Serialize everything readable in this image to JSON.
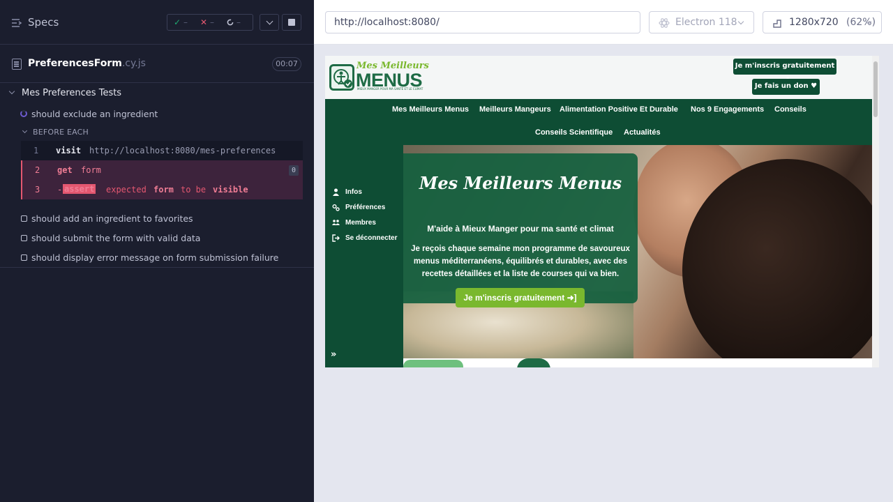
{
  "reporter": {
    "title": "Specs",
    "stats": {
      "passed": "✓",
      "passed_count": "–",
      "failed": "✕",
      "failed_count": "–",
      "pending_count": "–"
    },
    "file": {
      "name": "PreferencesForm",
      "ext": ".cy.js",
      "duration": "00:07"
    },
    "suite": {
      "title": "Mes Preferences Tests",
      "running_test": "should exclude an ingredient",
      "hook_label": "BEFORE EACH",
      "commands": [
        {
          "num": "1",
          "name": "visit",
          "message": "http://localhost:8080/mes-preferences"
        },
        {
          "num": "2",
          "name": "get",
          "message": "form",
          "count": "0"
        },
        {
          "num": "3",
          "prefix": "-",
          "name": "assert",
          "message_parts": [
            "expected",
            "form",
            "to be",
            "visible"
          ]
        }
      ],
      "pending_tests": [
        "should add an ingredient to favorites",
        "should submit the form with valid data",
        "should display error message on form submission failure"
      ]
    }
  },
  "topbar": {
    "url": "http://localhost:8080/",
    "browser": "Electron 118",
    "viewport": "1280x720",
    "scale": "(62%)"
  },
  "site": {
    "logo_script": "Mes Meilleurs",
    "logo_main": "MENUS",
    "logo_tagline": "MIEUX MANGER POUR MA SANTÉ ET LE CLIMAT",
    "header_buttons": {
      "signup": "Je m'inscris gratuitement ➜]",
      "donate": "Je fais un don ♥"
    },
    "nav_row1": [
      "Mes Meilleurs Menus",
      "Meilleurs Mangeurs",
      "Alimentation Positive Et Durable",
      "Nos 9 Engagements",
      "Conseils"
    ],
    "nav_row2": [
      "Conseils Scientifique",
      "Actualités"
    ],
    "sidebar": [
      "Infos",
      "Préférences",
      "Membres",
      "Se déconnecter"
    ],
    "hero": {
      "title": "Mes Meilleurs Menus",
      "subtitle": "M'aide à Mieux Manger pour ma santé et climat",
      "text": "Je reçois chaque semaine mon programme de savoureux menus méditerranéens, équilibrés et durables, avec des recettes détaillées et la liste de courses qui va bien.",
      "cta": "Je m'inscris gratuitement ➜]"
    },
    "expand_icon": "»"
  },
  "colors": {
    "brand_dark": "#0e4d34",
    "brand_light": "#7ab82e",
    "reporter_bg": "#1b1e2e",
    "error": "#e45770"
  }
}
